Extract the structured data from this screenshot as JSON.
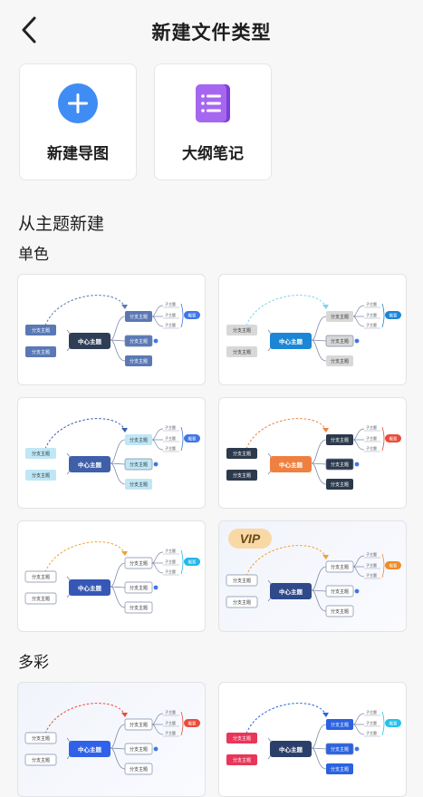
{
  "header": {
    "title": "新建文件类型"
  },
  "create": [
    {
      "label": "新建导图",
      "icon": "plus-circle-icon",
      "color": "#3f8cf5"
    },
    {
      "label": "大纲笔记",
      "icon": "outline-note-icon",
      "color": "#a667f0"
    }
  ],
  "sections": {
    "from_theme": "从主题新建",
    "mono": "单色",
    "colorful": "多彩"
  },
  "mindmap": {
    "center": "中心主题",
    "branch": "分支主题",
    "sub": "子主题",
    "summary": "概要"
  },
  "vip_badge": "VIP",
  "templates": [
    {
      "style": "navy",
      "center": "#2f3e57",
      "branch": "#5a78b5",
      "side": "#5a78b5",
      "curve": "#5a78b5",
      "summary": "#3f76e6",
      "text": "#ffffff"
    },
    {
      "style": "blue",
      "center": "#1b86d6",
      "branch": "#d8d8d8",
      "side": "#d8d8d8",
      "curve": "#7fd0f2",
      "summary": "#1b86d6",
      "text": "#333333"
    },
    {
      "style": "light-blue",
      "center": "#3f5fa8",
      "branch": "#bfe7f6",
      "side": "#bfe7f6",
      "curve": "#3a5db0",
      "summary": "#3f76e6",
      "text": "#333333"
    },
    {
      "style": "dark-orange",
      "center": "#f08040",
      "branch": "#2d3a4d",
      "side": "#2d3a4d",
      "curve": "#f08040",
      "summary": "#e94b3a",
      "text": "#ffffff"
    },
    {
      "style": "outline-blue",
      "center": "#3558b6",
      "branch": "#ffffff",
      "side": "#ffffff",
      "curve": "#f0a030",
      "summary": "#26b7e8",
      "text": "#333333"
    },
    {
      "style": "vip-navy",
      "center": "#2e4a8a",
      "branch": "#ffffff",
      "side": "#ffffff",
      "curve": "#f0a030",
      "summary": "#f08a2a",
      "text": "#333333",
      "vip": true
    },
    {
      "style": "gradient",
      "center": "#2f62e8",
      "branch": "#ffffff",
      "side": "#ffffff",
      "curve": "#e94b3a",
      "summary": "#e94b3a",
      "text": "#333333"
    },
    {
      "style": "multicolor",
      "center": "#2b3f6b",
      "branch": "#2b62e0",
      "side": "#e8365a",
      "curve": "#2b62e0",
      "summary": "#26c1e8",
      "text": "#ffffff"
    }
  ]
}
